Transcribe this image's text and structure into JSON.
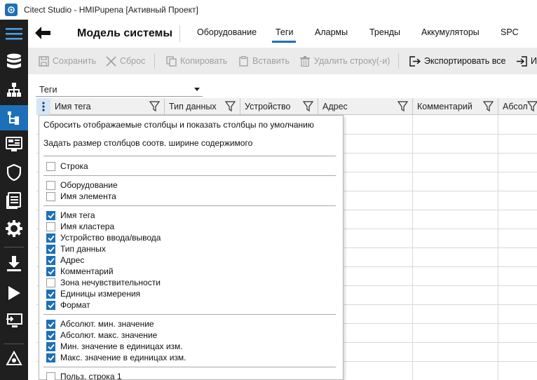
{
  "window": {
    "title": "Citect Studio - HMIPupena [Активный Проект]"
  },
  "header": {
    "title": "Модель системы",
    "tabs": [
      {
        "label": "Оборудование",
        "active": false
      },
      {
        "label": "Теги",
        "active": true
      },
      {
        "label": "Алармы",
        "active": false
      },
      {
        "label": "Тренды",
        "active": false
      },
      {
        "label": "Аккумуляторы",
        "active": false
      },
      {
        "label": "SPC",
        "active": false
      }
    ]
  },
  "toolbar": {
    "save": "Сохранить",
    "reset": "Сброс",
    "copy": "Копировать",
    "paste": "Вставить",
    "delete_rows": "Удалить строку(-и)",
    "export_all": "Экспортировать все",
    "import": "И"
  },
  "source_select": {
    "value": "Теги"
  },
  "grid": {
    "columns": [
      {
        "label": "Имя тега"
      },
      {
        "label": "Тип данных"
      },
      {
        "label": "Устройство"
      },
      {
        "label": "Адрес"
      },
      {
        "label": "Комментарий"
      },
      {
        "label": "Абсол"
      }
    ]
  },
  "column_menu": {
    "actions": [
      "Сбросить отображаемые столбцы и показать столбцы по умолчанию",
      "Задать размер столбцов соотв. ширине содержимого"
    ],
    "groups": [
      [
        {
          "label": "Строка",
          "checked": false
        }
      ],
      [
        {
          "label": "Оборудование",
          "checked": false
        },
        {
          "label": "Имя элемента",
          "checked": false
        }
      ],
      [
        {
          "label": "Имя тега",
          "checked": true
        },
        {
          "label": "Имя кластера",
          "checked": false
        },
        {
          "label": "Устройство ввода/вывода",
          "checked": true
        },
        {
          "label": "Тип данных",
          "checked": true
        },
        {
          "label": "Адрес",
          "checked": true
        },
        {
          "label": "Комментарий",
          "checked": true
        },
        {
          "label": "Зона нечувствительности",
          "checked": false
        },
        {
          "label": "Единицы измерения",
          "checked": true
        },
        {
          "label": "Формат",
          "checked": true
        }
      ],
      [
        {
          "label": "Абсолют. мин. значение",
          "checked": true
        },
        {
          "label": "Абсолют. макс. значение",
          "checked": true
        },
        {
          "label": "Мин. значение в единицах изм.",
          "checked": true
        },
        {
          "label": "Макс. значение в единицах изм.",
          "checked": true
        }
      ],
      [
        {
          "label": "Польз. строка 1",
          "checked": false
        }
      ]
    ]
  },
  "colors": {
    "accent": "#1d70b8",
    "rail_bg": "#1f1f1f",
    "toolbar_bg": "#ebebeb",
    "disabled_text": "#a0a0a0"
  },
  "icons": {
    "rail": [
      "menu-icon",
      "database-icon",
      "hierarchy-icon",
      "tags-tree-icon",
      "graphics-icon",
      "shield-icon",
      "document-list-icon",
      "gear-icon",
      "download-icon",
      "play-icon",
      "screen-icon",
      "deploy-icon"
    ]
  }
}
